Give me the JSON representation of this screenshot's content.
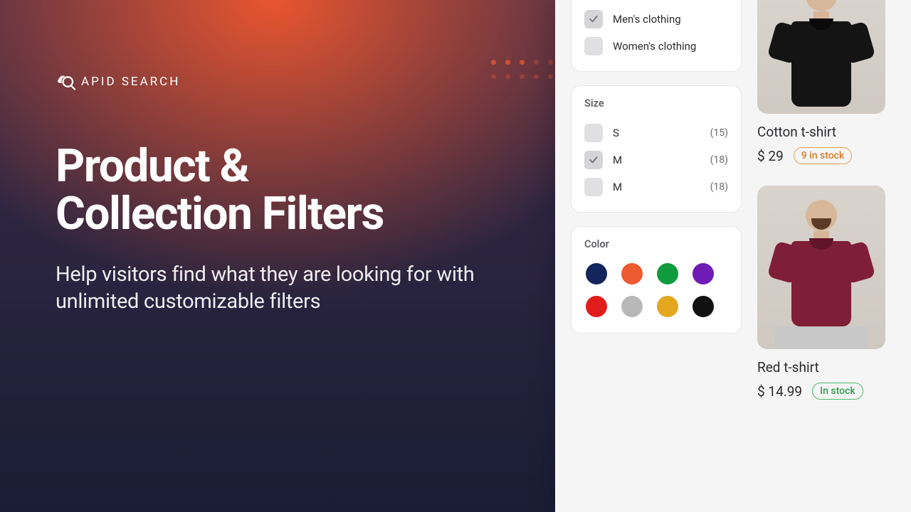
{
  "brand": {
    "name": "APID",
    "suffix": "SEARCH"
  },
  "hero": {
    "title_line1": "Product &",
    "title_line2": "Collection Filters",
    "subtitle": "Help visitors find what they are looking for with unlimited customizable filters"
  },
  "filters": {
    "category": {
      "items": [
        {
          "label": "Men's clothing",
          "checked": true
        },
        {
          "label": "Women's clothing",
          "checked": false
        }
      ]
    },
    "size": {
      "heading": "Size",
      "items": [
        {
          "label": "S",
          "count": "(15)",
          "checked": false
        },
        {
          "label": "M",
          "count": "(18)",
          "checked": true
        },
        {
          "label": "M",
          "count": "(18)",
          "checked": false
        }
      ]
    },
    "color": {
      "heading": "Color",
      "swatches": [
        "#13255a",
        "#ec5a2f",
        "#109b3e",
        "#6f1bb5",
        "#e21b1b",
        "#b8b8b8",
        "#e3a81f",
        "#111111"
      ]
    }
  },
  "products": [
    {
      "name": "Cotton t-shirt",
      "price": "$ 29",
      "stock": "9 in stock",
      "stock_variant": "orange",
      "tee": "black"
    },
    {
      "name": "Red t-shirt",
      "price": "$ 14.99",
      "stock": "In stock",
      "stock_variant": "green",
      "tee": "maroon"
    }
  ]
}
